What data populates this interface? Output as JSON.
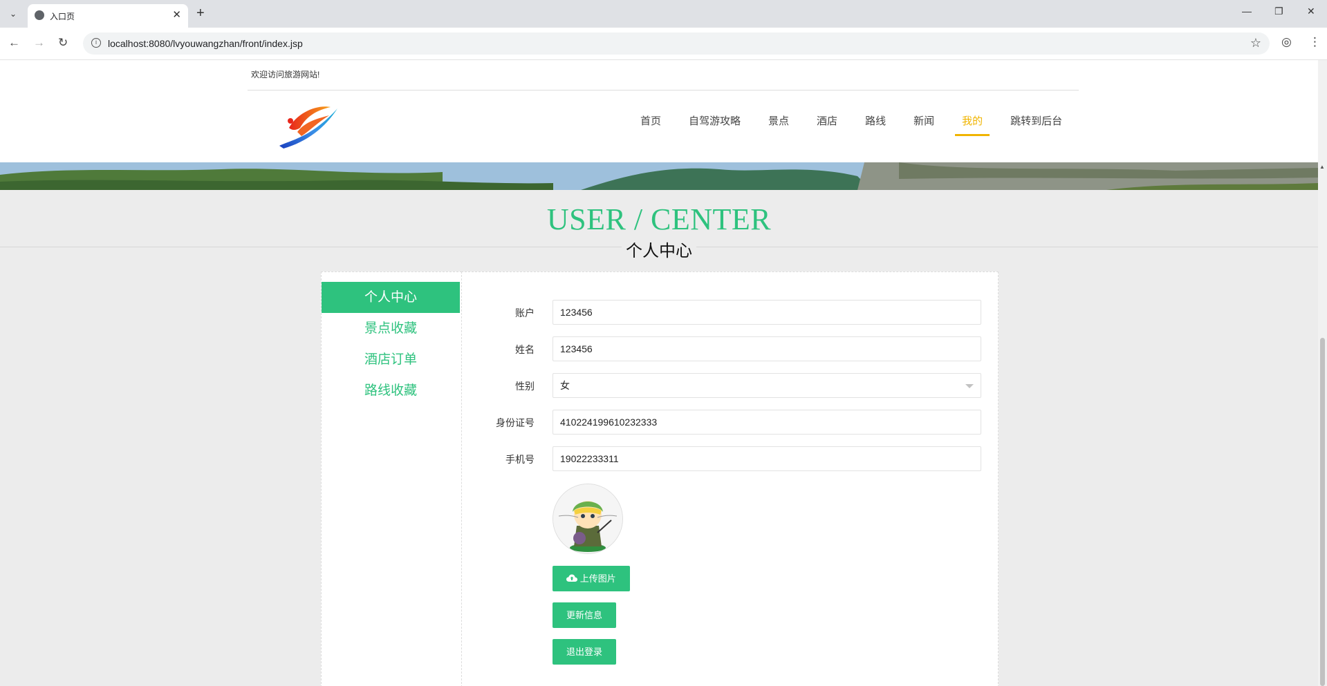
{
  "browser": {
    "tab_title": "入口页",
    "url": "localhost:8080/lvyouwangzhan/front/index.jsp"
  },
  "header": {
    "welcome": "欢迎访问旅游网站!",
    "nav": [
      {
        "label": "首页",
        "active": false
      },
      {
        "label": "自驾游攻略",
        "active": false
      },
      {
        "label": "景点",
        "active": false
      },
      {
        "label": "酒店",
        "active": false
      },
      {
        "label": "路线",
        "active": false
      },
      {
        "label": "新闻",
        "active": false
      },
      {
        "label": "我的",
        "active": true
      },
      {
        "label": "跳转到后台",
        "active": false
      }
    ]
  },
  "section": {
    "title_en": "USER / CENTER",
    "title_cn": "个人中心"
  },
  "sidebar": {
    "items": [
      {
        "label": "个人中心",
        "active": true
      },
      {
        "label": "景点收藏",
        "active": false
      },
      {
        "label": "酒店订单",
        "active": false
      },
      {
        "label": "路线收藏",
        "active": false
      }
    ]
  },
  "form": {
    "account": {
      "label": "账户",
      "value": "123456"
    },
    "name": {
      "label": "姓名",
      "value": "123456"
    },
    "gender": {
      "label": "性别",
      "value": "女"
    },
    "id_number": {
      "label": "身份证号",
      "value": "410224199610232333"
    },
    "phone": {
      "label": "手机号",
      "value": "19022233311"
    },
    "upload_label": "上传图片",
    "update_label": "更新信息",
    "logout_label": "退出登录"
  },
  "colors": {
    "accent": "#2ec27e",
    "nav_active": "#f0b400"
  }
}
